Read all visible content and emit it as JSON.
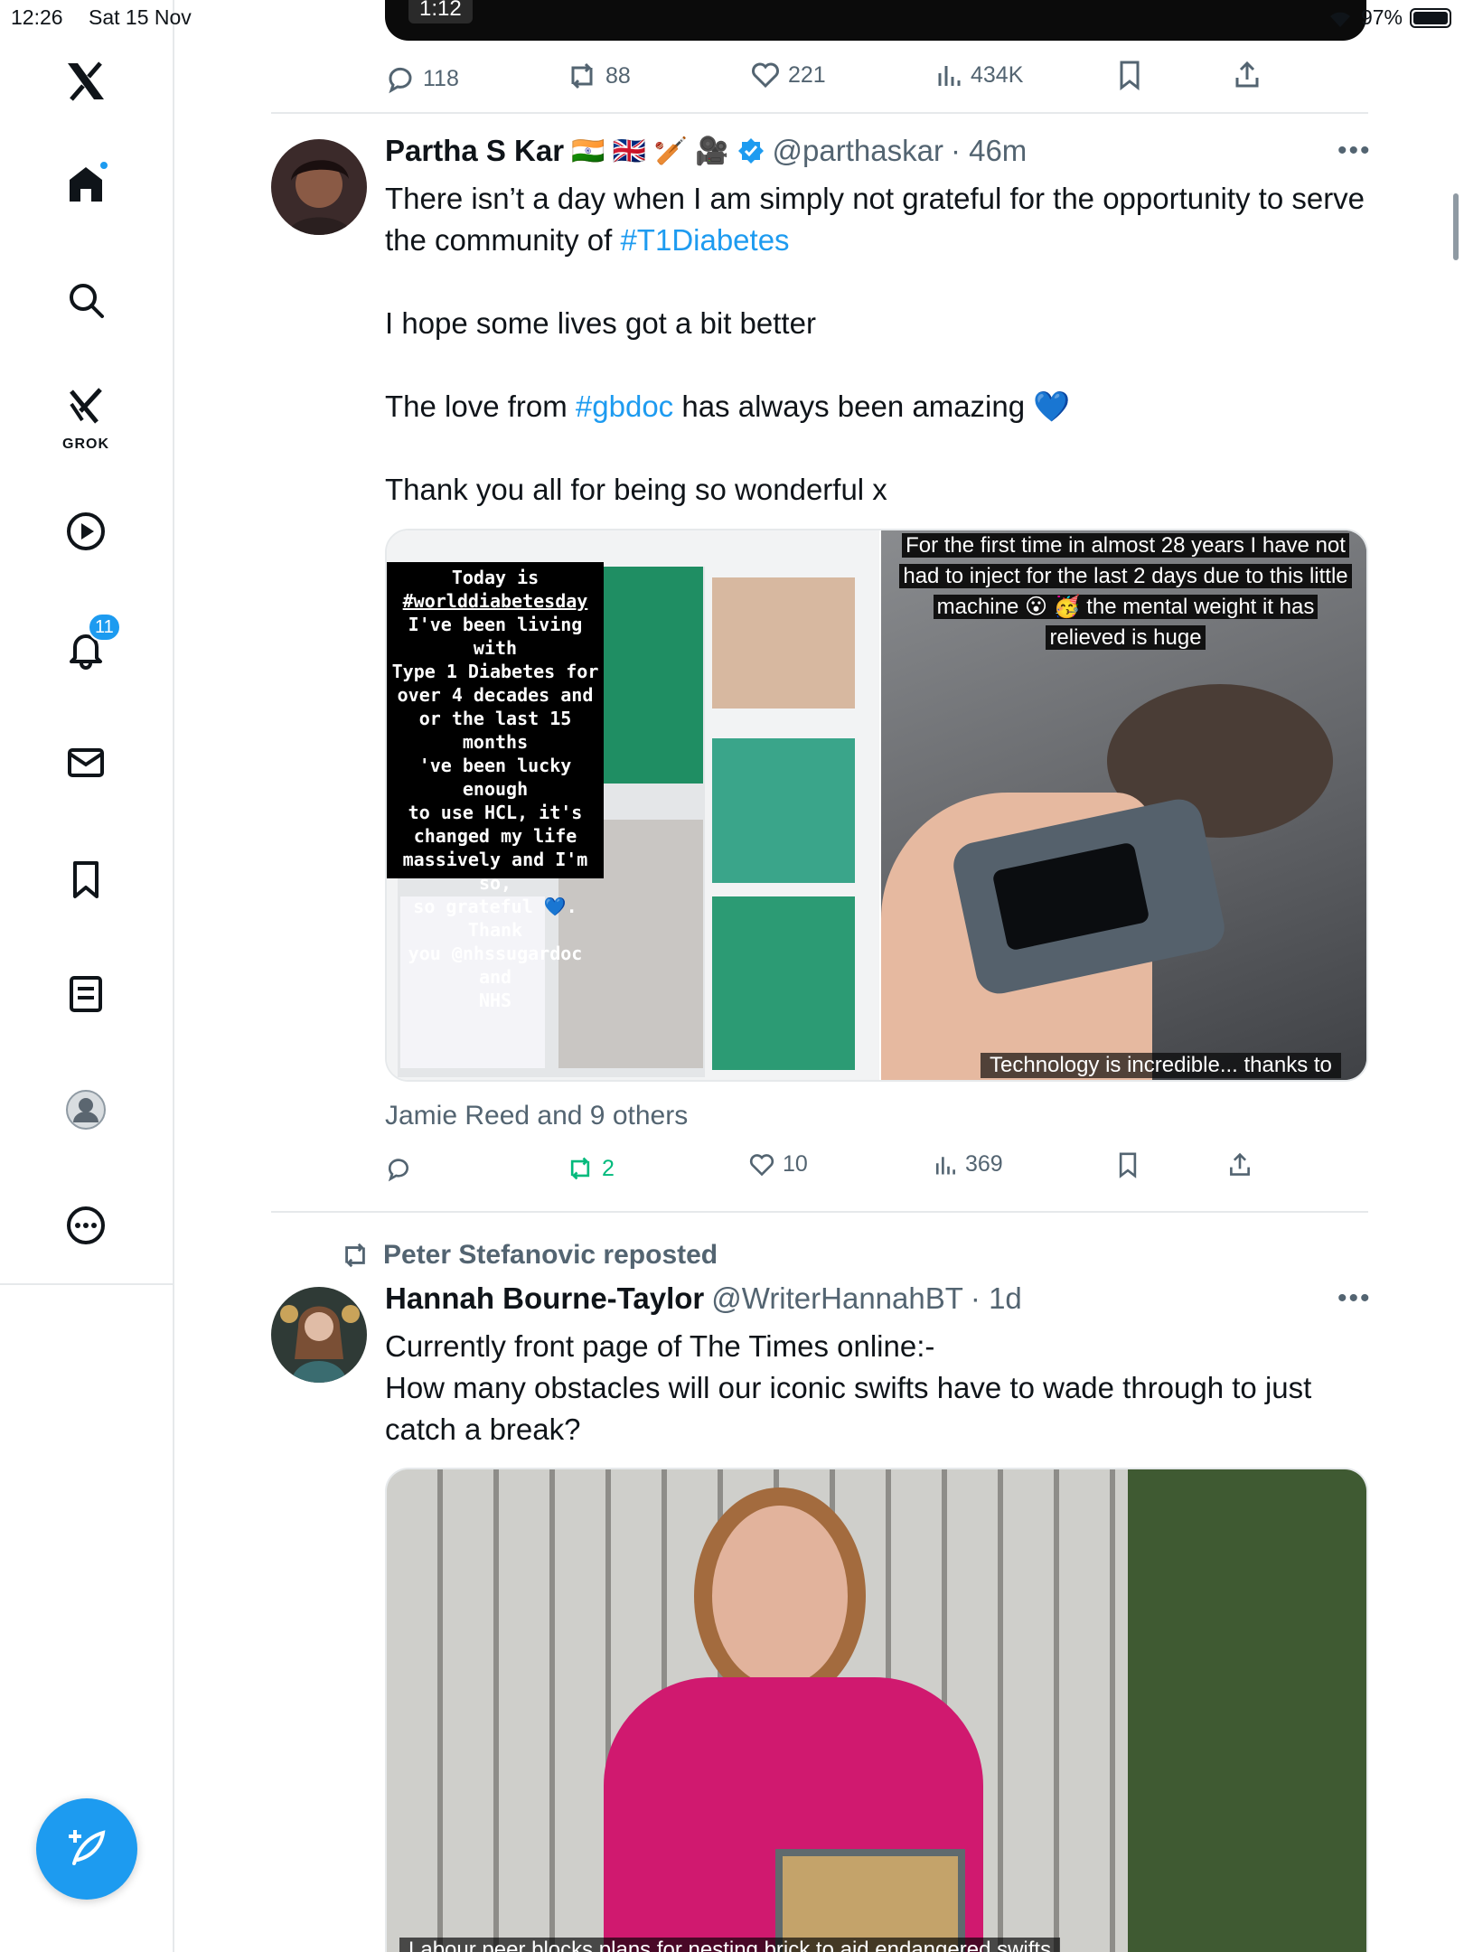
{
  "status_bar": {
    "time": "12:26",
    "date": "Sat 15 Nov",
    "battery": "97%"
  },
  "sidebar": {
    "grok_label": "GROK",
    "notifications_badge": "11"
  },
  "top_tweet": {
    "video_time": "1:12",
    "replies": "118",
    "reposts": "88",
    "likes": "221",
    "views": "434K"
  },
  "tweet1": {
    "name": "Partha S Kar",
    "emojis": "🇮🇳 🇬🇧 🏏 🎥",
    "handle": "@parthaskar",
    "time": "· 46m",
    "line1a": "There isn’t a day when I am simply not grateful for the opportunity to serve the community of ",
    "hashtag1": "#T1Diabetes",
    "line2": "I hope some lives got a bit better",
    "line3a": "The love from ",
    "hashtag2": "#gbdoc",
    "line3b": " has always been amazing 💙",
    "line4": "Thank you all for being so wonderful x",
    "story_left": [
      "Today is",
      "#worlddiabetesday",
      "I've been living with",
      "Type 1 Diabetes for",
      "over 4 decades and",
      "or the last 15 months",
      "'ve been lucky enough",
      "to use HCL, it's",
      "changed my life",
      "massively and I'm so,",
      "so grateful 💙. Thank",
      "you @nhssugardoc and",
      "NHS"
    ],
    "story_right": [
      "For the first time in almost 28 years I have not",
      "had to inject for the last 2 days due to this little",
      "machine 😮 🥳 the mental weight it has",
      "relieved is huge"
    ],
    "story_right_bottom": "Technology is incredible... thanks to",
    "social_context": "Jamie Reed and 9 others",
    "replies": "",
    "reposts": "2",
    "likes": "10",
    "views": "369"
  },
  "tweet2": {
    "repost_by": "Peter Stefanovic reposted",
    "name": "Hannah Bourne-Taylor",
    "handle": "@WriterHannahBT",
    "time": "· 1d",
    "text1": "Currently front page of The Times online:-",
    "text2": "How many obstacles will our iconic swifts have to wade through to just catch a break?",
    "media_caption": "Labour peer blocks plans for nesting brick to aid endangered swifts"
  },
  "colors": {
    "accent": "#1d9bf0",
    "repost_green": "#00ba7c",
    "muted": "#536471"
  }
}
